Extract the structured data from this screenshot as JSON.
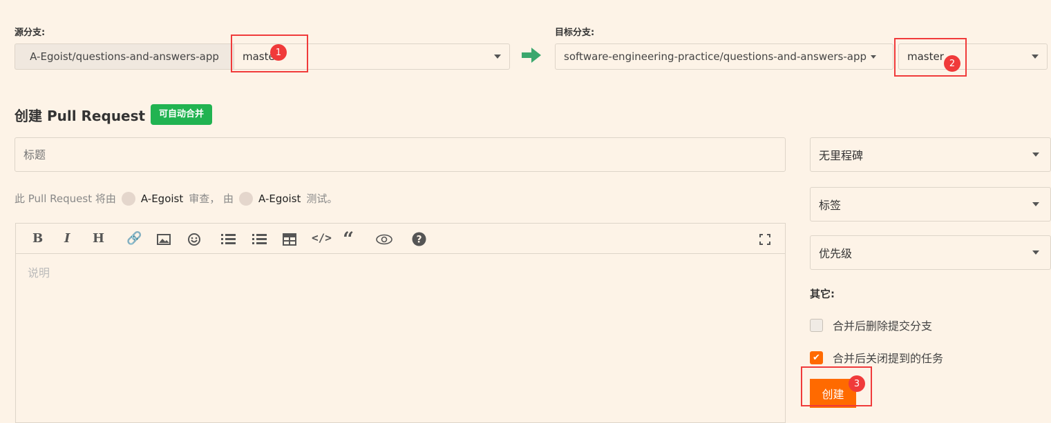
{
  "source": {
    "label": "源分支:",
    "repo": "A-Egoist/questions-and-answers-app",
    "branch": "master"
  },
  "target": {
    "label": "目标分支:",
    "repo": "software-engineering-practice/questions-and-answers-app",
    "branch": "master"
  },
  "heading": {
    "title": "创建 Pull Request",
    "badge": "可自动合并"
  },
  "title_input": {
    "placeholder": "标题",
    "value": ""
  },
  "reviewers": {
    "prefix": "此 Pull Request 将由",
    "reviewer": "A-Egoist",
    "mid": "审查， 由",
    "tester": "A-Egoist",
    "suffix": "测试。"
  },
  "editor": {
    "placeholder": "说明",
    "toolbar": [
      "bold-icon",
      "italic-icon",
      "heading-icon",
      "link-icon",
      "image-icon",
      "emoji-icon",
      "bullet-list-icon",
      "numbered-list-icon",
      "table-icon",
      "code-icon",
      "quote-icon",
      "preview-icon",
      "help-icon",
      "fullscreen-icon"
    ]
  },
  "sidebar": {
    "milestone": "无里程碑",
    "labels": "标签",
    "priority": "优先级",
    "other_label": "其它:",
    "options": [
      {
        "label": "合并后删除提交分支",
        "checked": false
      },
      {
        "label": "合并后关闭提到的任务",
        "checked": true
      }
    ],
    "create_button": "创建"
  },
  "annotations": [
    "1",
    "2",
    "3"
  ],
  "colors": {
    "accent": "#ff6a00",
    "green": "#21b351",
    "annotation": "#f03a3a"
  }
}
